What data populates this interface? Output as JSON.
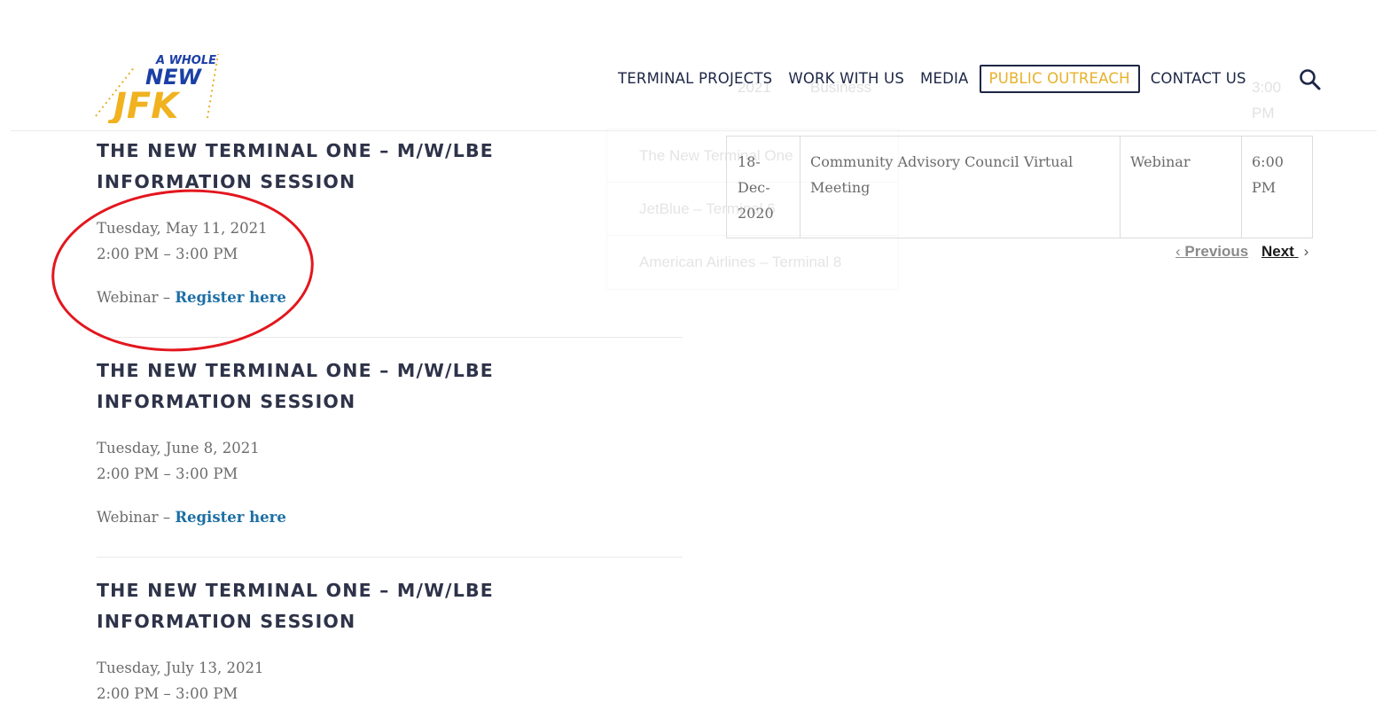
{
  "header": {
    "logo": {
      "line1": "A WHOLE",
      "line2": "NEW",
      "line3": "JFK"
    },
    "nav": [
      {
        "label": "TERMINAL PROJECTS",
        "active": false
      },
      {
        "label": "WORK WITH US",
        "active": false
      },
      {
        "label": "MEDIA",
        "active": false
      },
      {
        "label": "PUBLIC OUTREACH",
        "active": true
      },
      {
        "label": "CONTACT US",
        "active": false
      }
    ],
    "search_icon": "search-icon"
  },
  "dropdown_ghost": {
    "items": [
      "The New Terminal One",
      "JetBlue – Terminal 6",
      "American Airlines – Terminal 8"
    ]
  },
  "ghost_row": {
    "date": "2021",
    "title": "Business",
    "time_1": "3:00",
    "time_2": "PM"
  },
  "table": {
    "row": {
      "date_1": "18-",
      "date_2": "Dec-",
      "date_3": "2020",
      "title_1": "Community Advisory Council Virtual",
      "title_2": "Meeting",
      "venue": "Webinar",
      "time_1": "6:00",
      "time_2": "PM"
    },
    "pager": {
      "previous": "Previous",
      "next": "Next"
    }
  },
  "events": [
    {
      "title": "THE NEW TERMINAL ONE – M/W/LBE INFORMATION SESSION",
      "date": "Tuesday, May 11, 2021",
      "time": "2:00 PM – 3:00 PM",
      "venue_prefix": "Webinar – ",
      "link_label": "Register here"
    },
    {
      "title": "THE NEW TERMINAL ONE – M/W/LBE INFORMATION SESSION",
      "date": "Tuesday, June 8, 2021",
      "time": "2:00 PM – 3:00 PM",
      "venue_prefix": "Webinar – ",
      "link_label": "Register here"
    },
    {
      "title": "THE NEW TERMINAL ONE – M/W/LBE INFORMATION SESSION",
      "date": "Tuesday, July 13, 2021",
      "time": "2:00 PM – 3:00 PM"
    }
  ],
  "colors": {
    "navy": "#1c2645",
    "gold": "#e7b12a",
    "logo_blue": "#1b3fa6",
    "link": "#1c6fa5",
    "annotation": "#e3161d"
  }
}
